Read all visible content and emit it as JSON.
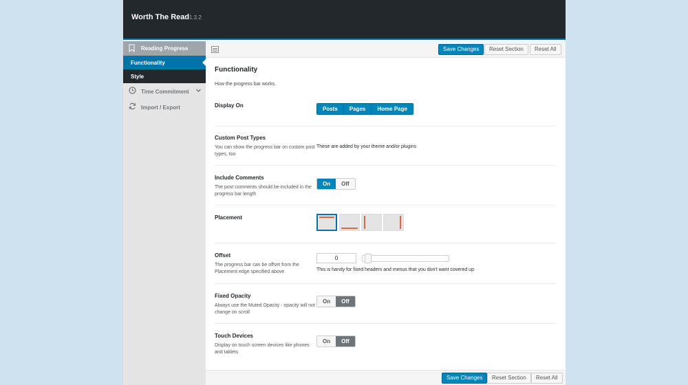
{
  "header": {
    "title": "Worth The Read",
    "version": "1.3.2"
  },
  "sidebar": {
    "head": {
      "label": "Reading Progress",
      "icon": "bookmark-icon"
    },
    "subitems": [
      {
        "label": "Functionality",
        "active": true
      },
      {
        "label": "Style",
        "active": false
      }
    ],
    "items": [
      {
        "label": "Time Commitment",
        "icon": "clock-icon",
        "has_chevron": true
      },
      {
        "label": "Import / Export",
        "icon": "refresh-icon",
        "has_chevron": false
      }
    ]
  },
  "toolbar": {
    "save_label": "Save Changes",
    "reset_section_label": "Reset Section",
    "reset_all_label": "Reset All"
  },
  "section": {
    "title": "Functionality",
    "description": "How the progress bar works."
  },
  "options": {
    "display_on": {
      "label": "Display On",
      "choices": [
        "Posts",
        "Pages",
        "Home Page"
      ]
    },
    "custom_post_types": {
      "label": "Custom Post Types",
      "description": "You can show the progress bar on custom post types, too",
      "note": "These are added by your theme and/or plugins"
    },
    "include_comments": {
      "label": "Include Comments",
      "description": "The post comments should be included in the progress bar length",
      "on_label": "On",
      "off_label": "Off",
      "value": "On"
    },
    "placement": {
      "label": "Placement",
      "choices": [
        "top",
        "bottom",
        "left",
        "right"
      ],
      "selected": "top"
    },
    "offset": {
      "label": "Offset",
      "description": "The progress bar can be offset from the Placement edge specified above",
      "value": "0",
      "note": "This is handy for fixed headers and menus that you don't want covered up"
    },
    "fixed_opacity": {
      "label": "Fixed Opacity",
      "description": "Always use the Muted Opacity - opacity will not change on scroll",
      "on_label": "On",
      "off_label": "Off",
      "value": "Off"
    },
    "touch_devices": {
      "label": "Touch Devices",
      "description": "Display on touch screen devices like phones and tablets",
      "on_label": "On",
      "off_label": "Off",
      "value": "Off"
    }
  },
  "colors": {
    "accent": "#0085ba",
    "header_bg": "#23282d",
    "placement_marker": "#d86a45"
  }
}
